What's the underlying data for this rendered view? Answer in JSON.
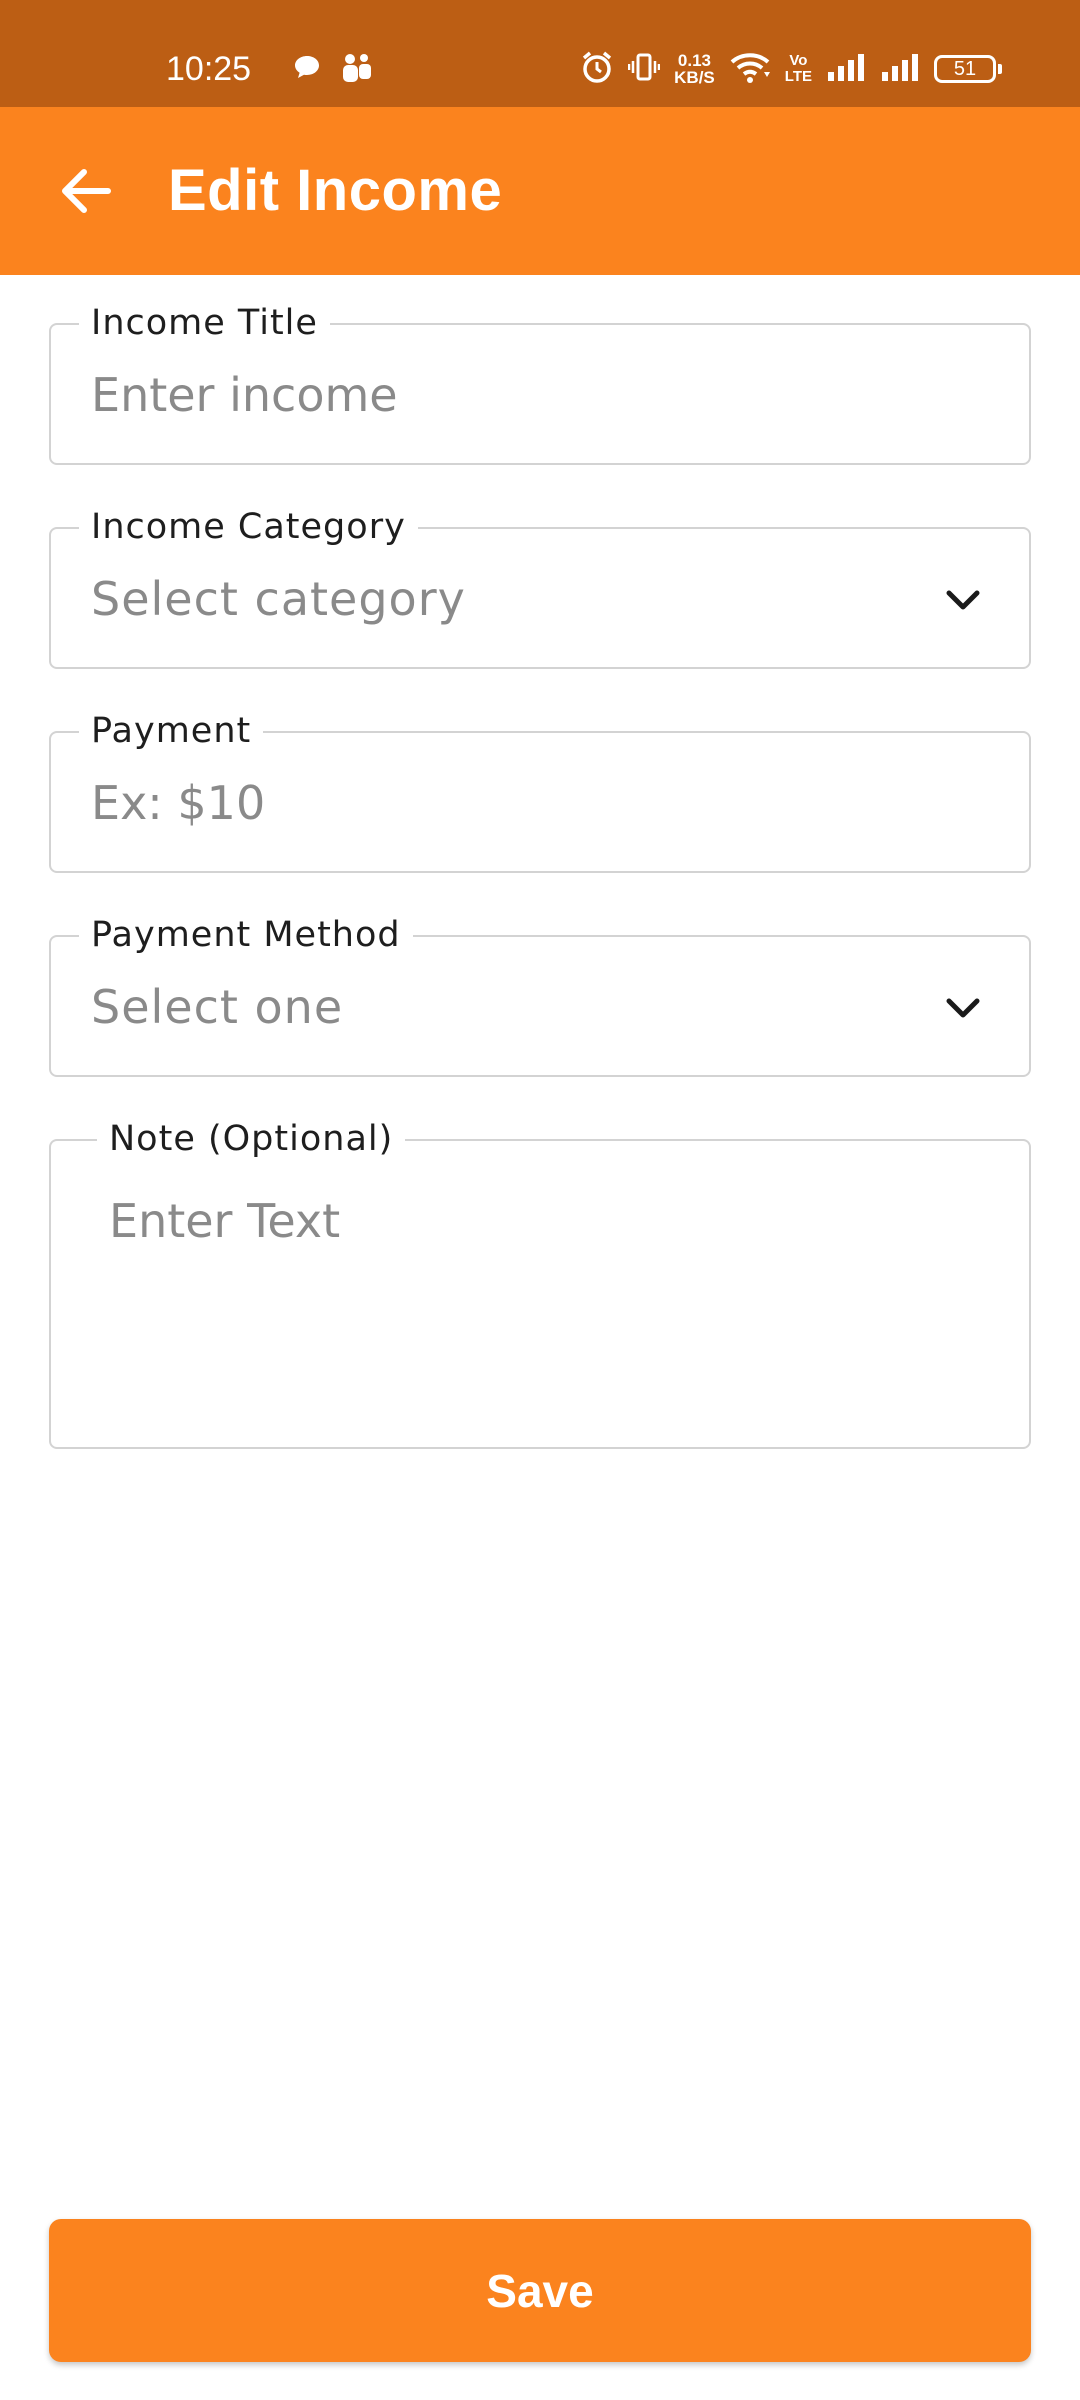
{
  "status_bar": {
    "time": "10:25",
    "net_speed_value": "0.13",
    "net_speed_unit": "KB/S",
    "volte_top": "Vo",
    "volte_bottom": "LTE",
    "battery_level": "51"
  },
  "app_bar": {
    "title": "Edit Income",
    "back_icon": "arrow-left-icon",
    "color": "#fb831e"
  },
  "form": {
    "income_title": {
      "label": "Income Title",
      "placeholder": "Enter income"
    },
    "income_category": {
      "label": "Income Category",
      "selected": "Select category"
    },
    "payment": {
      "label": "Payment",
      "placeholder": "Ex: $10"
    },
    "payment_method": {
      "label": "Payment Method",
      "selected": "Select one"
    },
    "note": {
      "label": "Note (Optional)",
      "placeholder": "Enter Text"
    }
  },
  "save_button": {
    "label": "Save",
    "color": "#fb831e"
  }
}
